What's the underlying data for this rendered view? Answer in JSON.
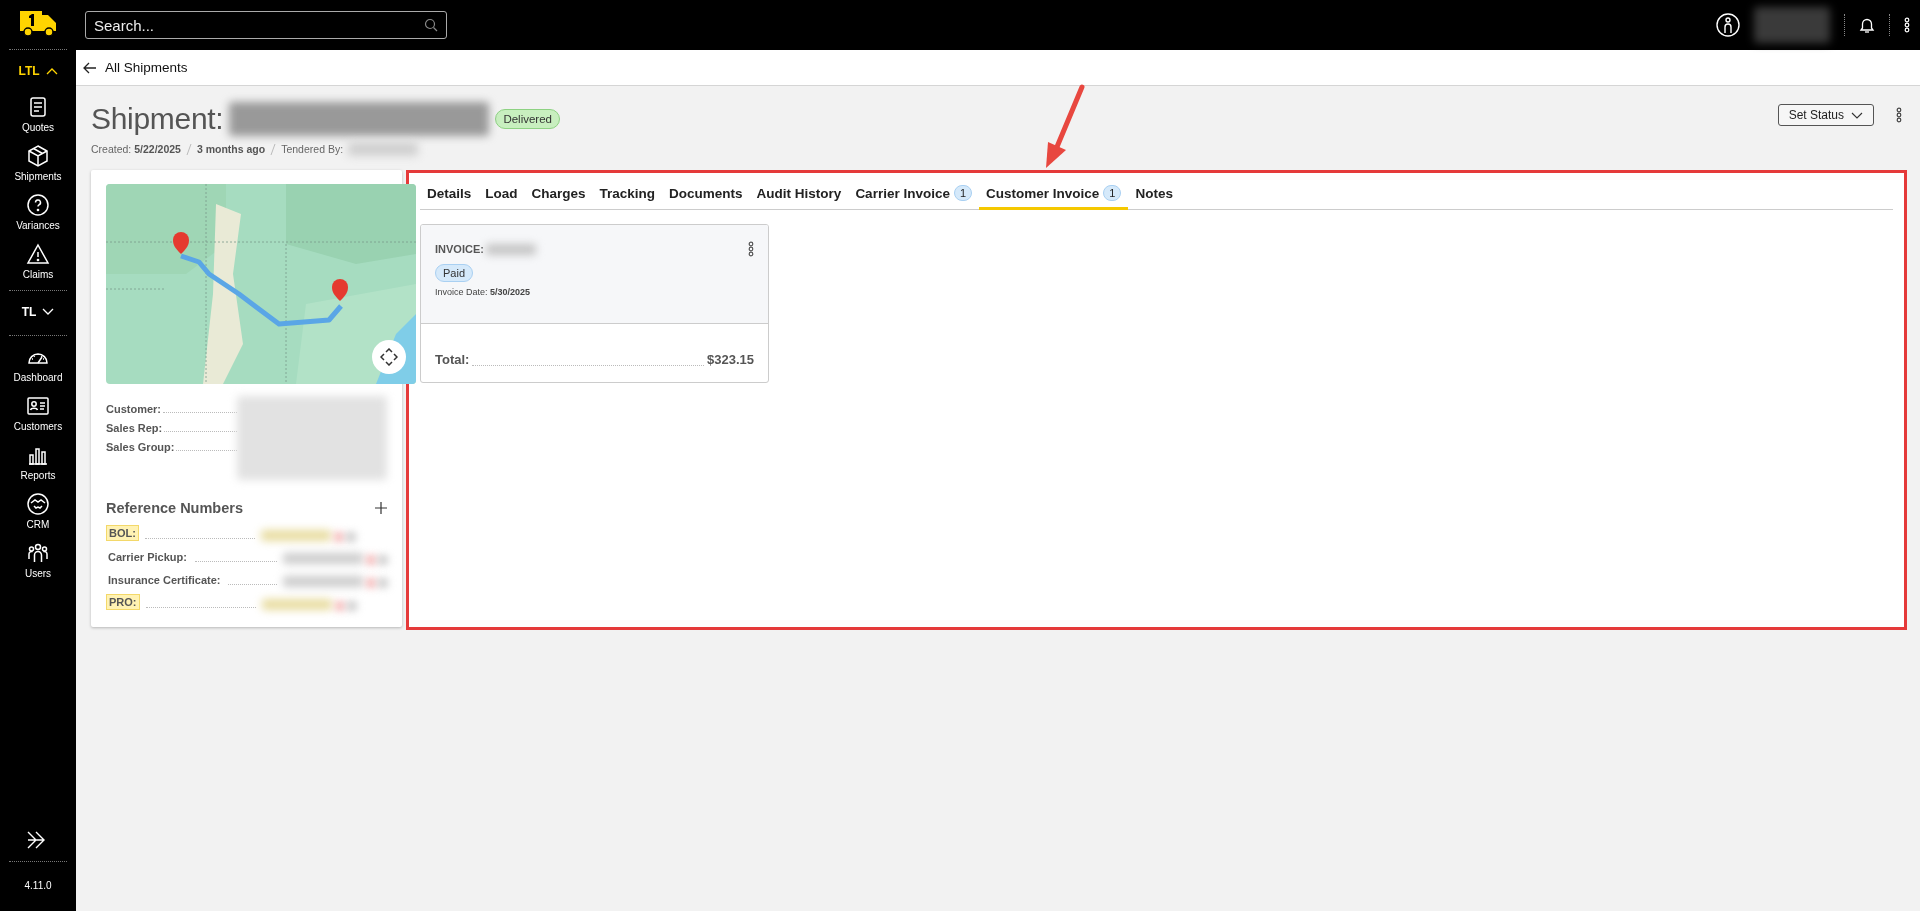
{
  "header": {
    "search": {
      "placeholder": "Search..."
    }
  },
  "sidebar": {
    "groups": [
      {
        "label": "LTL",
        "expanded": true,
        "items": [
          "Quotes",
          "Shipments",
          "Variances",
          "Claims"
        ]
      },
      {
        "label": "TL",
        "expanded": false
      }
    ],
    "items": [
      "Dashboard",
      "Customers",
      "Reports",
      "CRM",
      "Users"
    ],
    "version": "4.11.0"
  },
  "breadcrumb": {
    "label": "All Shipments"
  },
  "shipment": {
    "title": "Shipment:",
    "status": "Delivered",
    "meta": [
      {
        "label": "Created:",
        "value": "5/22/2025"
      },
      {
        "value": "3 months ago"
      },
      {
        "label": "Tendered By:"
      }
    ],
    "set_status": "Set Status"
  },
  "summary": {
    "fields": [
      {
        "label": "Customer:"
      },
      {
        "label": "Sales Rep:"
      },
      {
        "label": "Sales Group:"
      }
    ],
    "reference_numbers": {
      "title": "Reference Numbers",
      "rows": [
        {
          "label": "BOL:",
          "highlighted": true
        },
        {
          "label": "Carrier Pickup:",
          "highlighted": false
        },
        {
          "label": "Insurance Certificate:",
          "highlighted": false
        },
        {
          "label": "PRO:",
          "highlighted": true
        }
      ]
    }
  },
  "tabs": [
    {
      "label": "Details",
      "selected": false
    },
    {
      "label": "Load",
      "selected": false
    },
    {
      "label": "Charges",
      "selected": false
    },
    {
      "label": "Tracking",
      "selected": false
    },
    {
      "label": "Documents",
      "selected": false
    },
    {
      "label": "Audit History",
      "selected": false
    },
    {
      "label": "Carrier Invoice",
      "count": "1",
      "selected": false
    },
    {
      "label": "Customer Invoice",
      "count": "1",
      "selected": true
    },
    {
      "label": "Notes",
      "selected": false
    }
  ],
  "invoice": {
    "label": "INVOICE:",
    "status": "Paid",
    "date_label": "Invoice Date:",
    "date": "5/30/2025",
    "total_label": "Total:",
    "total": "$323.15"
  }
}
